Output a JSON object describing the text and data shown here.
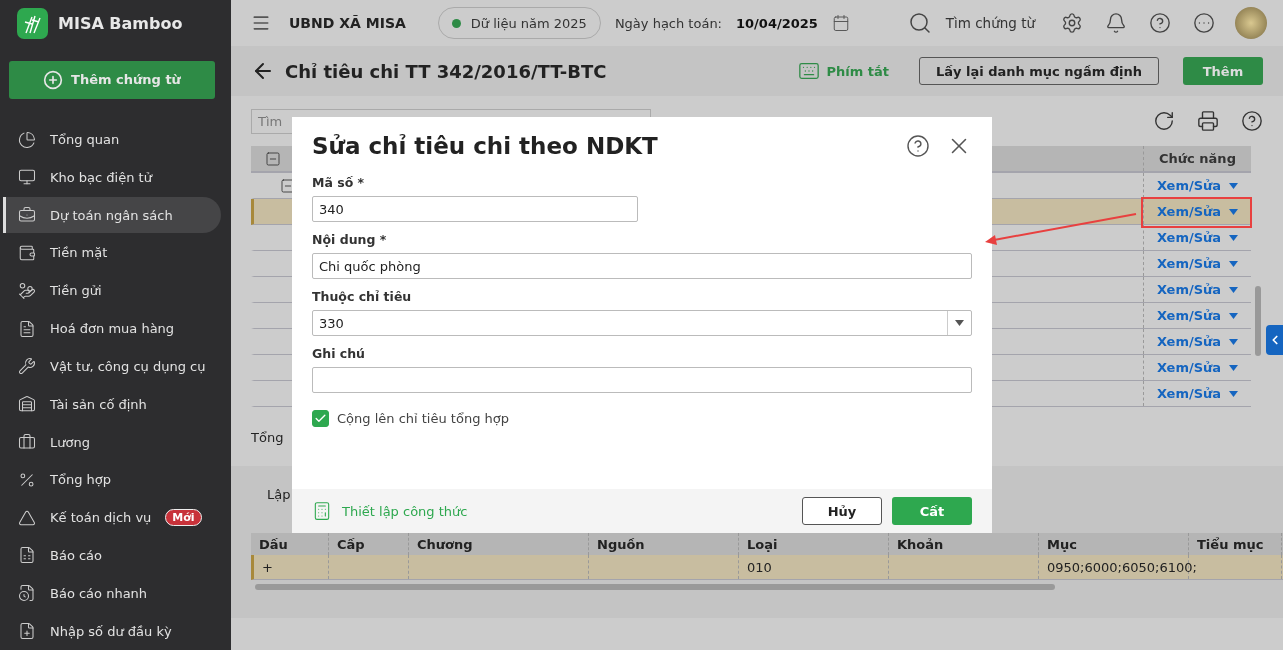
{
  "app": {
    "name": "MISA Bamboo"
  },
  "sidebar": {
    "add_button": "Thêm chứng từ",
    "items": [
      {
        "label": "Tổng quan",
        "selected": false
      },
      {
        "label": "Kho bạc điện tử",
        "selected": false
      },
      {
        "label": "Dự toán ngân sách",
        "selected": true
      },
      {
        "label": "Tiền mặt",
        "selected": false
      },
      {
        "label": "Tiền gửi",
        "selected": false
      },
      {
        "label": "Hoá đơn mua hàng",
        "selected": false
      },
      {
        "label": "Vật tư, công cụ dụng cụ",
        "selected": false
      },
      {
        "label": "Tài sản cố định",
        "selected": false
      },
      {
        "label": "Lương",
        "selected": false
      },
      {
        "label": "Tổng hợp",
        "selected": false
      },
      {
        "label": "Kế toán dịch vụ",
        "selected": false,
        "badge": "Mới"
      },
      {
        "label": "Báo cáo",
        "selected": false
      },
      {
        "label": "Báo cáo nhanh",
        "selected": false
      },
      {
        "label": "Nhập số dư đầu kỳ",
        "selected": false
      }
    ]
  },
  "topbar": {
    "org": "UBND XÃ MISA",
    "data_year": "Dữ liệu năm 2025",
    "posting_date_label": "Ngày hạch toán:",
    "posting_date": "10/04/2025",
    "search": "Tìm chứng từ"
  },
  "page": {
    "title": "Chỉ tiêu chi TT 342/2016/TT-BTC",
    "shortcut": "Phím tắt",
    "reset_button": "Lấy lại danh mục ngầm định",
    "add_button": "Thêm"
  },
  "search": {
    "placeholder": "Tìm"
  },
  "table": {
    "expanded": true,
    "function_column": "Chức năng",
    "rows": [
      {
        "kind": "group",
        "expanded": true,
        "action": "Xem/Sửa",
        "selected": false
      },
      {
        "kind": "leaf",
        "action": "Xem/Sửa",
        "selected": true
      },
      {
        "kind": "leaf",
        "action": "Xem/Sửa",
        "selected": false
      },
      {
        "kind": "leaf",
        "action": "Xem/Sửa",
        "selected": false
      },
      {
        "kind": "leaf",
        "action": "Xem/Sửa",
        "selected": false
      },
      {
        "kind": "leaf",
        "action": "Xem/Sửa",
        "selected": false
      },
      {
        "kind": "leaf",
        "action": "Xem/Sửa",
        "selected": false
      },
      {
        "kind": "leaf",
        "action": "Xem/Sửa",
        "selected": false
      },
      {
        "kind": "leaf",
        "action": "Xem/Sửa",
        "selected": false
      }
    ]
  },
  "total_label": "Tổng",
  "detail": {
    "tab": "Lập",
    "columns": [
      "Dấu",
      "Cấp",
      "Chương",
      "Nguồn",
      "Loại",
      "Khoản",
      "Mục",
      "Tiểu mục"
    ],
    "rows": [
      {
        "selected": true,
        "cells": [
          "+",
          null,
          null,
          null,
          "010",
          null,
          "0950;6000;6050;6100;",
          null
        ]
      }
    ]
  },
  "dialog": {
    "title": "Sửa chỉ tiêu chi theo NDKT",
    "fields": [
      {
        "kind": "short",
        "label": "Mã số *",
        "value": "340"
      },
      {
        "kind": "text",
        "label": "Nội dung *",
        "value": "Chi quốc phòng"
      },
      {
        "kind": "select",
        "label": "Thuộc chỉ tiêu",
        "value": "330"
      },
      {
        "kind": "text",
        "label": "Ghi chú"
      }
    ],
    "checkbox": {
      "label": "Cộng lên chỉ tiêu tổng hợp",
      "checked": true
    },
    "formula_link": "Thiết lập công thức",
    "cancel_button": "Hủy",
    "save_button": "Cất"
  }
}
